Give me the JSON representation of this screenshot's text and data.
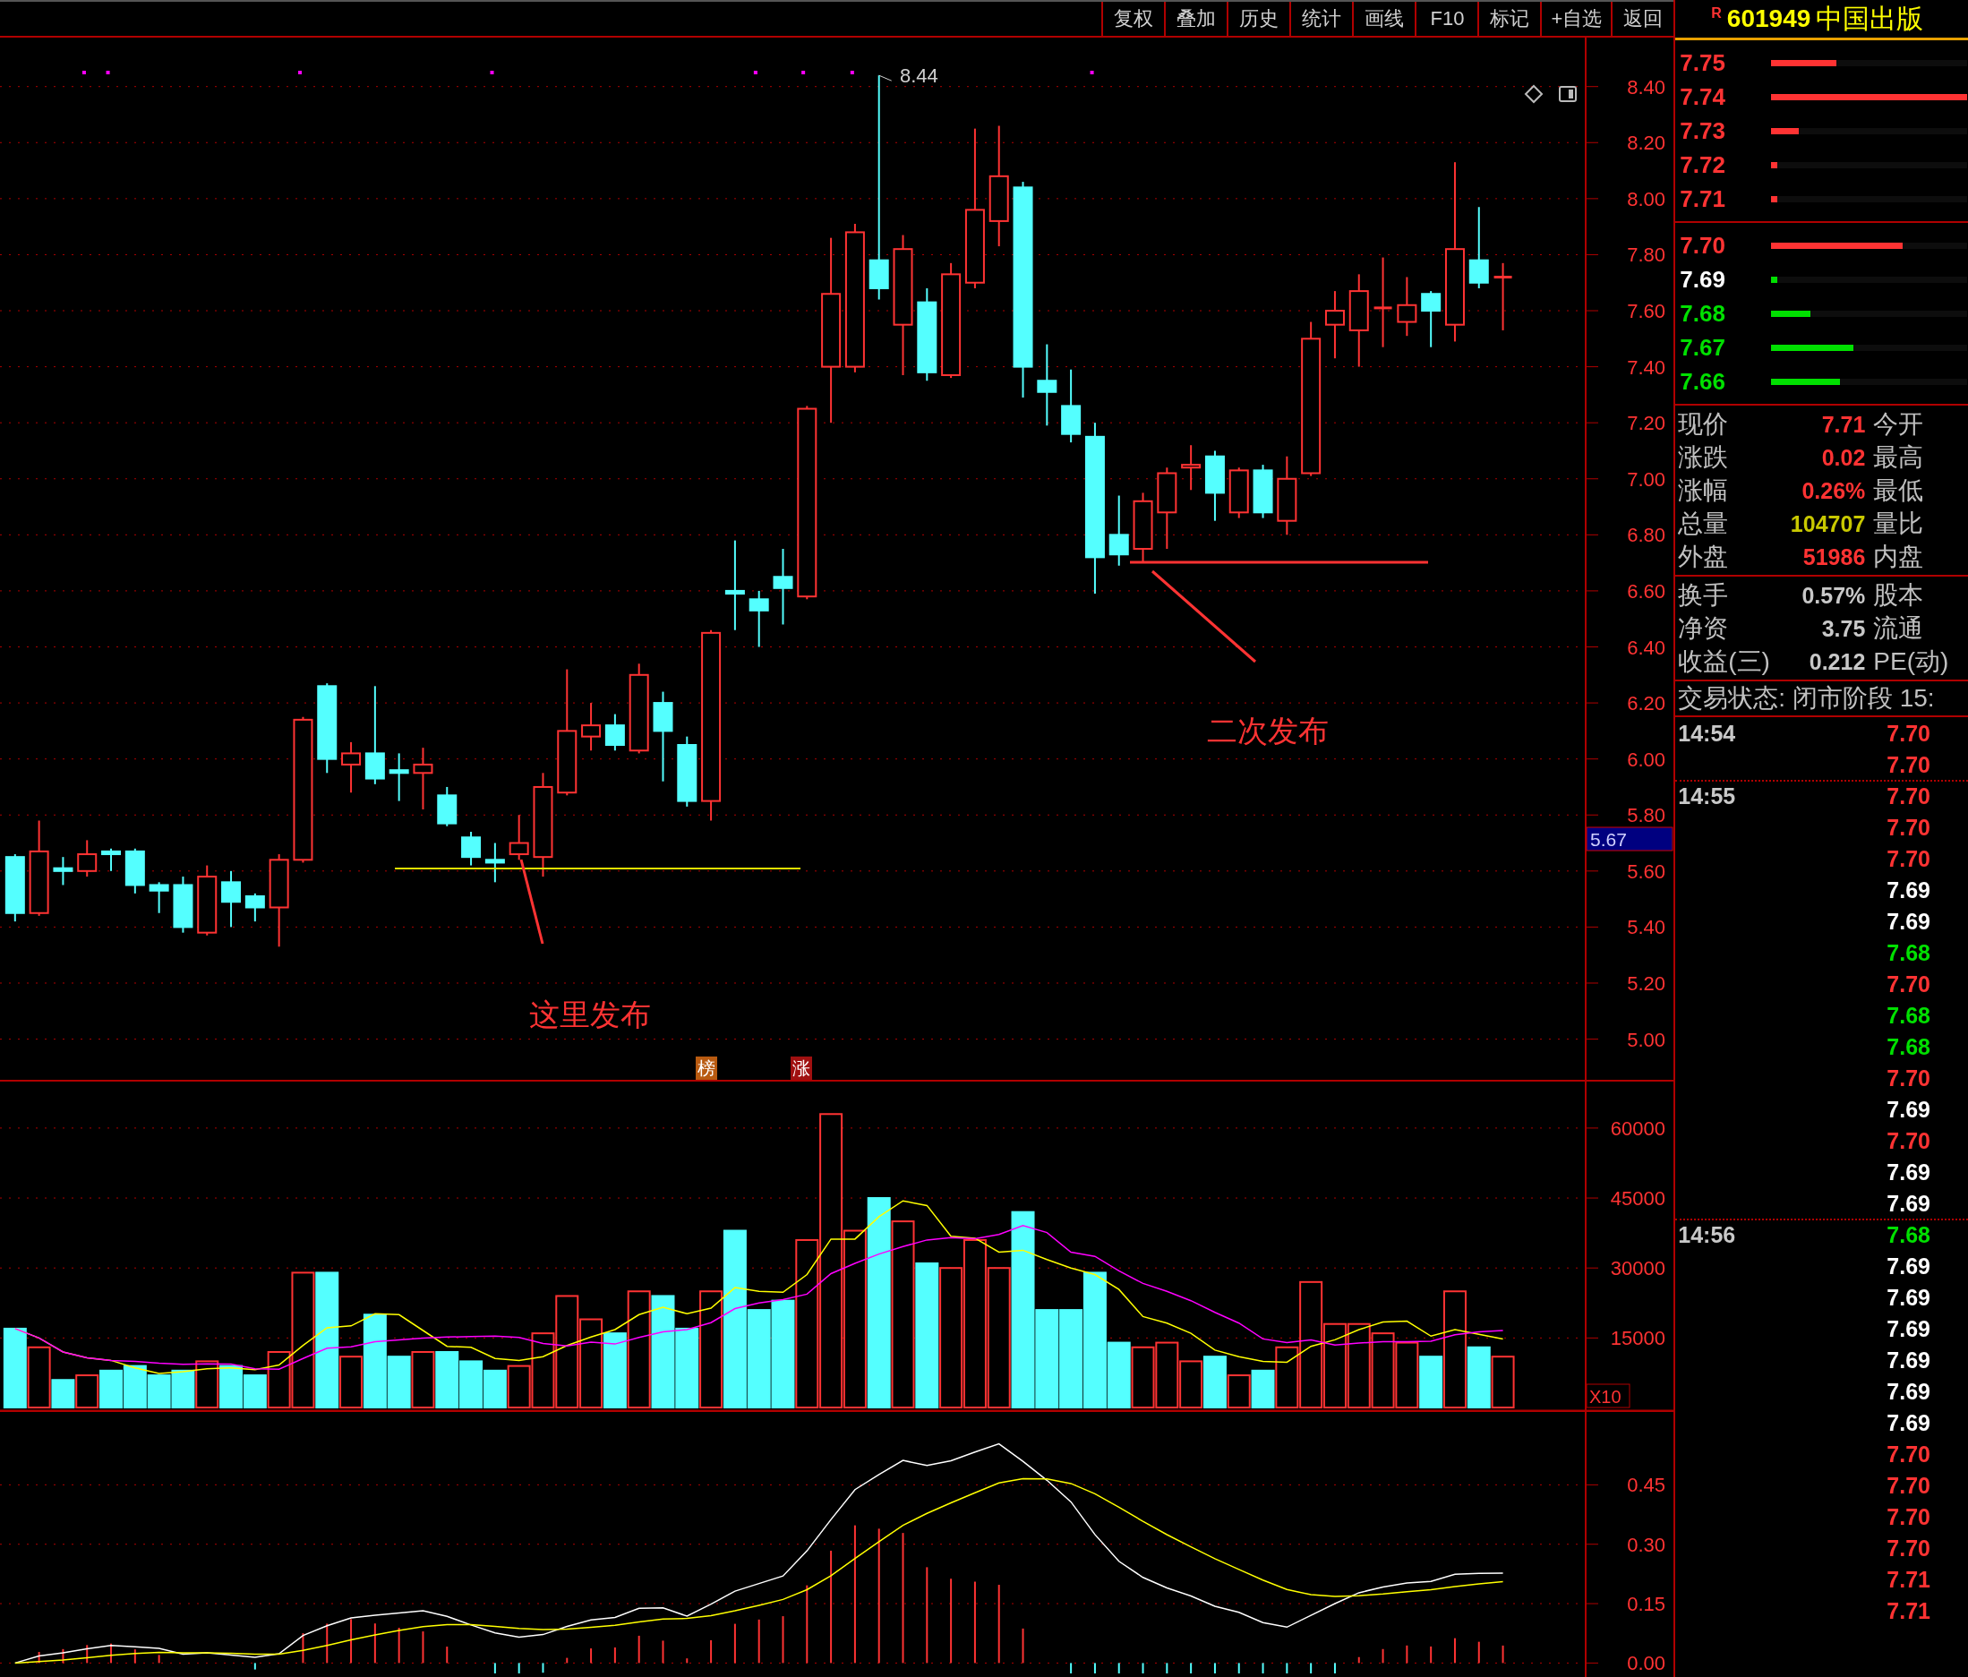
{
  "toolbar": {
    "buttons": [
      "复权",
      "叠加",
      "历史",
      "统计",
      "画线",
      "F10",
      "标记",
      "+自选",
      "返回"
    ]
  },
  "price_chart": {
    "marker_label": "8.44",
    "annotations": [
      "这里发布",
      "二次发布"
    ],
    "badges": [
      {
        "text": "榜",
        "color": "#b85a10"
      },
      {
        "text": "涨",
        "color": "#a01010"
      }
    ],
    "axis_labels": [
      "8.40",
      "8.20",
      "8.00",
      "7.80",
      "7.60",
      "7.40",
      "7.20",
      "7.00",
      "6.80",
      "6.60",
      "6.40",
      "6.20",
      "6.00",
      "5.80",
      "5.60",
      "5.40",
      "5.20",
      "5.00"
    ],
    "price_tag": "5.67"
  },
  "volume_chart": {
    "axis_labels": [
      "60000",
      "45000",
      "30000",
      "15000"
    ],
    "unit": "X10"
  },
  "macd_chart": {
    "axis_labels": [
      "0.45",
      "0.30",
      "0.15",
      "0.00"
    ]
  },
  "quote": {
    "prefix": "R",
    "code": "601949",
    "name": "中国出版",
    "asks": [
      {
        "price": "7.75",
        "color": "#ff3333",
        "bar": {
          "color": "#ff3333",
          "level": 0.33
        }
      },
      {
        "price": "7.74",
        "color": "#ff3333",
        "bar": {
          "color": "#ff3333",
          "level": 1.0
        }
      },
      {
        "price": "7.73",
        "color": "#ff3333",
        "bar": {
          "color": "#ff3333",
          "level": 0.14
        }
      },
      {
        "price": "7.72",
        "color": "#ff3333",
        "bar": {
          "color": "#ff3333",
          "level": 0.03
        }
      },
      {
        "price": "7.71",
        "color": "#ff3333",
        "bar": {
          "color": "#ff3333",
          "level": 0.03
        }
      }
    ],
    "bids": [
      {
        "price": "7.70",
        "color": "#ff3333",
        "bar": {
          "color": "#ff3333",
          "level": 0.67
        }
      },
      {
        "price": "7.69",
        "color": "#ffffff",
        "bar": {
          "color": "#00e000",
          "level": 0.03
        }
      },
      {
        "price": "7.68",
        "color": "#00e000",
        "bar": {
          "color": "#00e000",
          "level": 0.2
        }
      },
      {
        "price": "7.67",
        "color": "#00e000",
        "bar": {
          "color": "#00e000",
          "level": 0.42
        }
      },
      {
        "price": "7.66",
        "color": "#00e000",
        "bar": {
          "color": "#00e000",
          "level": 0.35
        }
      }
    ],
    "stats": [
      {
        "label": "现价",
        "value": "7.71",
        "color": "#ff3333",
        "label2": "今开"
      },
      {
        "label": "涨跌",
        "value": "0.02",
        "color": "#ff3333",
        "label2": "最高"
      },
      {
        "label": "涨幅",
        "value": "0.26%",
        "color": "#ff3333",
        "label2": "最低"
      },
      {
        "label": "总量",
        "value": "104707",
        "color": "#c8c800",
        "label2": "量比"
      },
      {
        "label": "外盘",
        "value": "51986",
        "color": "#ff3333",
        "label2": "内盘"
      }
    ],
    "stats2": [
      {
        "label": "换手",
        "value": "0.57%",
        "color": "#c8c8c8",
        "label2": "股本"
      },
      {
        "label": "净资",
        "value": "3.75",
        "color": "#c8c8c8",
        "label2": "流通"
      },
      {
        "label": "收益(三)",
        "value": "0.212",
        "color": "#c8c8c8",
        "label2": "PE(动)"
      }
    ],
    "status": "交易状态: 闭市阶段 15:",
    "ticks": [
      {
        "time": "14:54",
        "price": "7.70",
        "color": "#ff3333"
      },
      {
        "price": "7.70",
        "color": "#ff3333"
      },
      {
        "time": "14:55",
        "price": "7.70",
        "color": "#ff3333"
      },
      {
        "price": "7.70",
        "color": "#ff3333"
      },
      {
        "price": "7.70",
        "color": "#ff3333"
      },
      {
        "price": "7.69",
        "color": "#ffffff"
      },
      {
        "price": "7.69",
        "color": "#ffffff"
      },
      {
        "price": "7.68",
        "color": "#00e000"
      },
      {
        "price": "7.70",
        "color": "#ff3333"
      },
      {
        "price": "7.68",
        "color": "#00e000"
      },
      {
        "price": "7.68",
        "color": "#00e000"
      },
      {
        "price": "7.70",
        "color": "#ff3333"
      },
      {
        "price": "7.69",
        "color": "#ffffff"
      },
      {
        "price": "7.70",
        "color": "#ff3333"
      },
      {
        "price": "7.69",
        "color": "#ffffff"
      },
      {
        "price": "7.69",
        "color": "#ffffff"
      },
      {
        "time": "14:56",
        "price": "7.68",
        "color": "#00e000"
      },
      {
        "price": "7.69",
        "color": "#ffffff"
      },
      {
        "price": "7.69",
        "color": "#ffffff"
      },
      {
        "price": "7.69",
        "color": "#ffffff"
      },
      {
        "price": "7.69",
        "color": "#ffffff"
      },
      {
        "price": "7.69",
        "color": "#ffffff"
      },
      {
        "price": "7.69",
        "color": "#ffffff"
      },
      {
        "price": "7.70",
        "color": "#ff3333"
      },
      {
        "price": "7.70",
        "color": "#ff3333"
      },
      {
        "price": "7.70",
        "color": "#ff3333"
      },
      {
        "price": "7.70",
        "color": "#ff3333"
      },
      {
        "price": "7.71",
        "color": "#ff3333"
      },
      {
        "price": "7.71",
        "color": "#ff3333"
      }
    ]
  }
}
